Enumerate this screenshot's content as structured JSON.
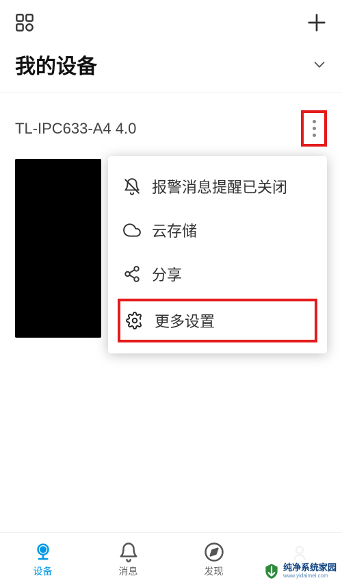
{
  "header": {
    "title": "我的设备"
  },
  "device": {
    "name": "TL-IPC633-A4 4.0"
  },
  "menu": {
    "alarm": {
      "label": "报警消息提醒已关闭",
      "icon": "bell-off-icon"
    },
    "cloud": {
      "label": "云存储",
      "icon": "cloud-icon"
    },
    "share": {
      "label": "分享",
      "icon": "share-icon"
    },
    "more": {
      "label": "更多设置",
      "icon": "gear-icon"
    }
  },
  "nav": {
    "device": {
      "label": "设备"
    },
    "message": {
      "label": "消息"
    },
    "discover": {
      "label": "发现"
    }
  },
  "watermark": {
    "main": "纯净系统家园",
    "url": "www.yidaimei.com"
  }
}
